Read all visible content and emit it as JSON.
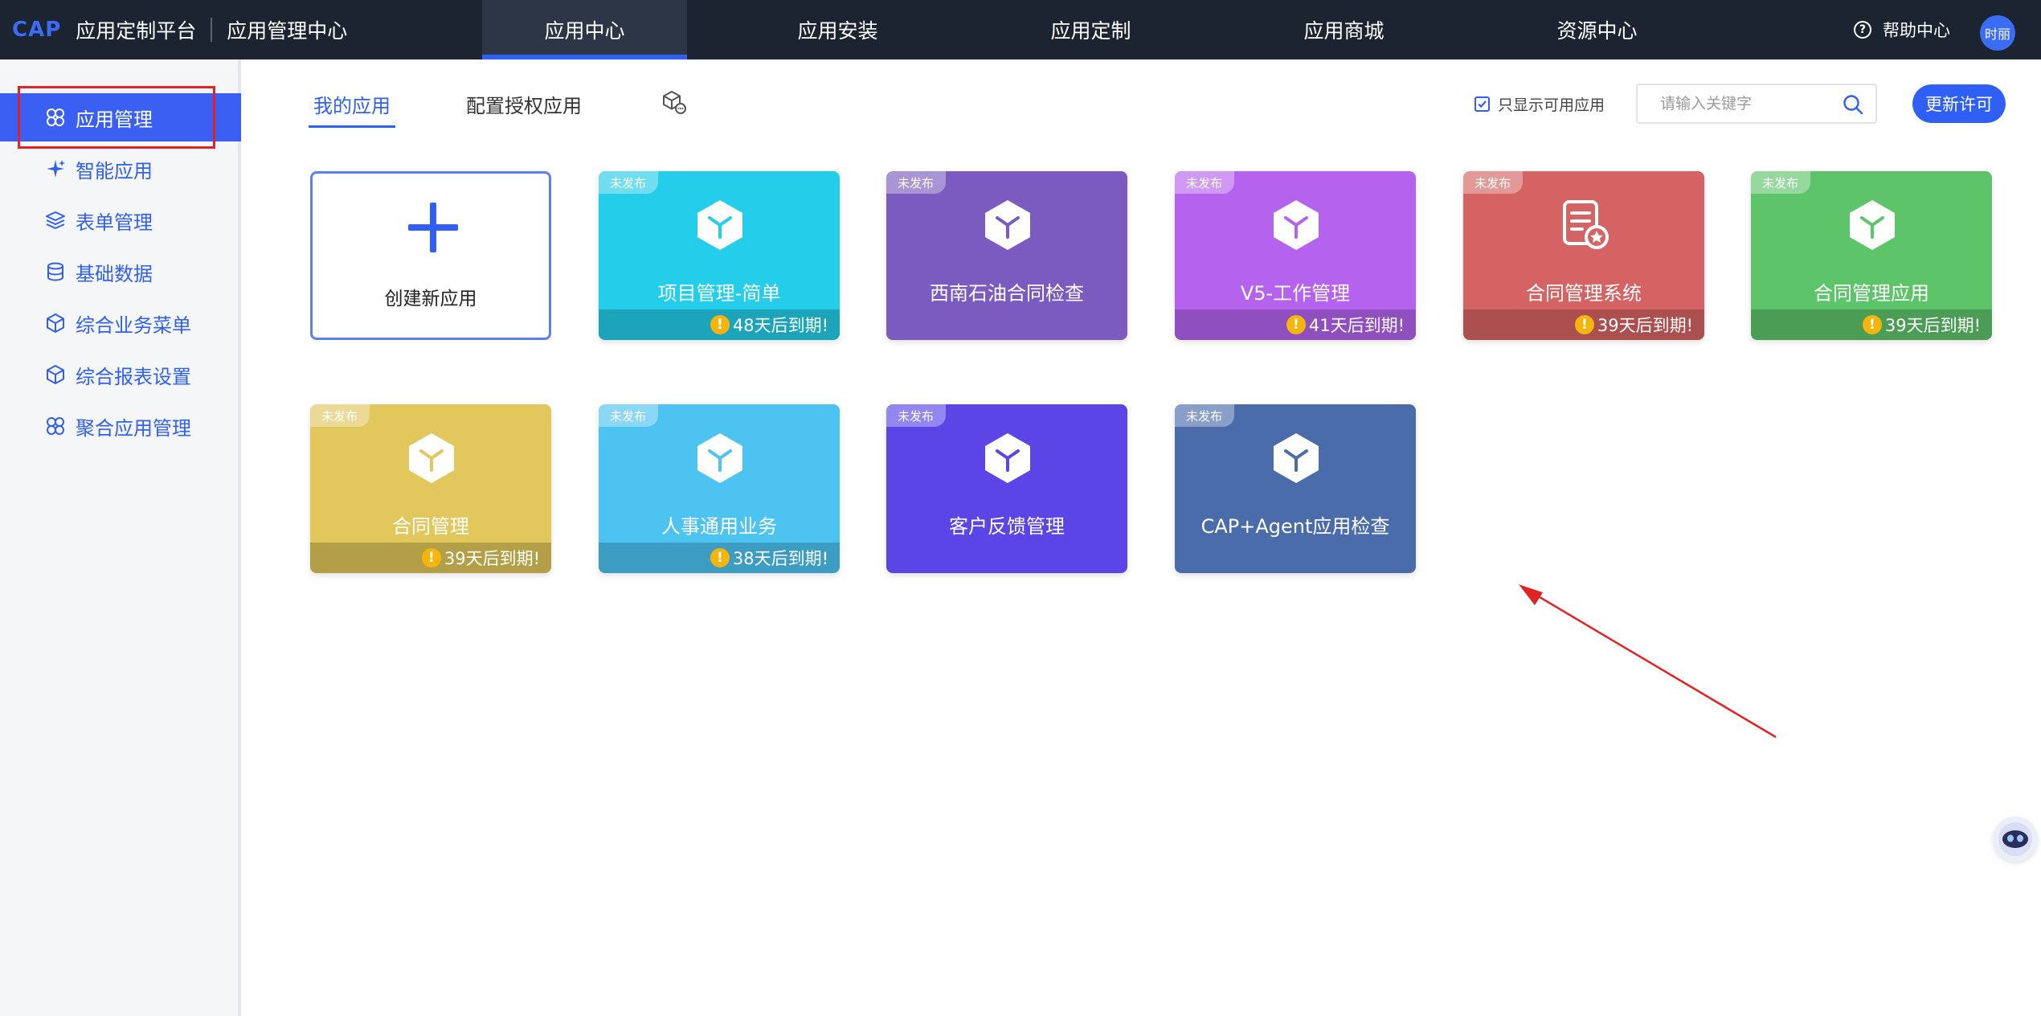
{
  "header": {
    "brand_cap": "CAP",
    "brand_platform": "应用定制平台",
    "brand_center": "应用管理中心",
    "tabs": [
      "应用中心",
      "应用安装",
      "应用定制",
      "应用商城",
      "资源中心"
    ],
    "help_label": "帮助中心",
    "avatar_text": "时丽"
  },
  "sidebar": {
    "items": [
      "应用管理",
      "智能应用",
      "表单管理",
      "基础数据",
      "综合业务菜单",
      "综合报表设置",
      "聚合应用管理"
    ]
  },
  "toolbar": {
    "tab_my_apps": "我的应用",
    "tab_authorized": "配置授权应用",
    "filter_label": "只显示可用应用",
    "search_placeholder": "请输入关键字",
    "update_button": "更新许可"
  },
  "create_card": {
    "label": "创建新应用"
  },
  "cards": [
    {
      "badge": "未发布",
      "name": "项目管理-简单",
      "expire": "48天后到期!",
      "color": "#24cde9",
      "icon": "cube-icon"
    },
    {
      "badge": "未发布",
      "name": "西南石油合同检查",
      "expire": "",
      "color": "#7b5bbf",
      "icon": "cube-icon"
    },
    {
      "badge": "未发布",
      "name": "V5-工作管理",
      "expire": "41天后到期!",
      "color": "#b563ee",
      "icon": "cube-icon"
    },
    {
      "badge": "未发布",
      "name": "合同管理系统",
      "expire": "39天后到期!",
      "color": "#d66363",
      "icon": "contract-icon"
    },
    {
      "badge": "未发布",
      "name": "合同管理应用",
      "expire": "39天后到期!",
      "color": "#5ec46a",
      "icon": "cube-icon"
    },
    {
      "badge": "未发布",
      "name": "合同管理",
      "expire": "39天后到期!",
      "color": "#e1c75c",
      "icon": "cube-icon"
    },
    {
      "badge": "未发布",
      "name": "人事通用业务",
      "expire": "38天后到期!",
      "color": "#4dc3f2",
      "icon": "cube-icon"
    },
    {
      "badge": "未发布",
      "name": "客户反馈管理",
      "expire": "",
      "color": "#5b45e6",
      "icon": "cube-icon"
    },
    {
      "badge": "未发布",
      "name": "CAP+Agent应用检查",
      "expire": "",
      "color": "#4b6cab",
      "icon": "cube-icon"
    }
  ],
  "colors": {
    "accent": "#2f5ff4",
    "topbar": "#1c2331",
    "annotation": "#e02424"
  }
}
